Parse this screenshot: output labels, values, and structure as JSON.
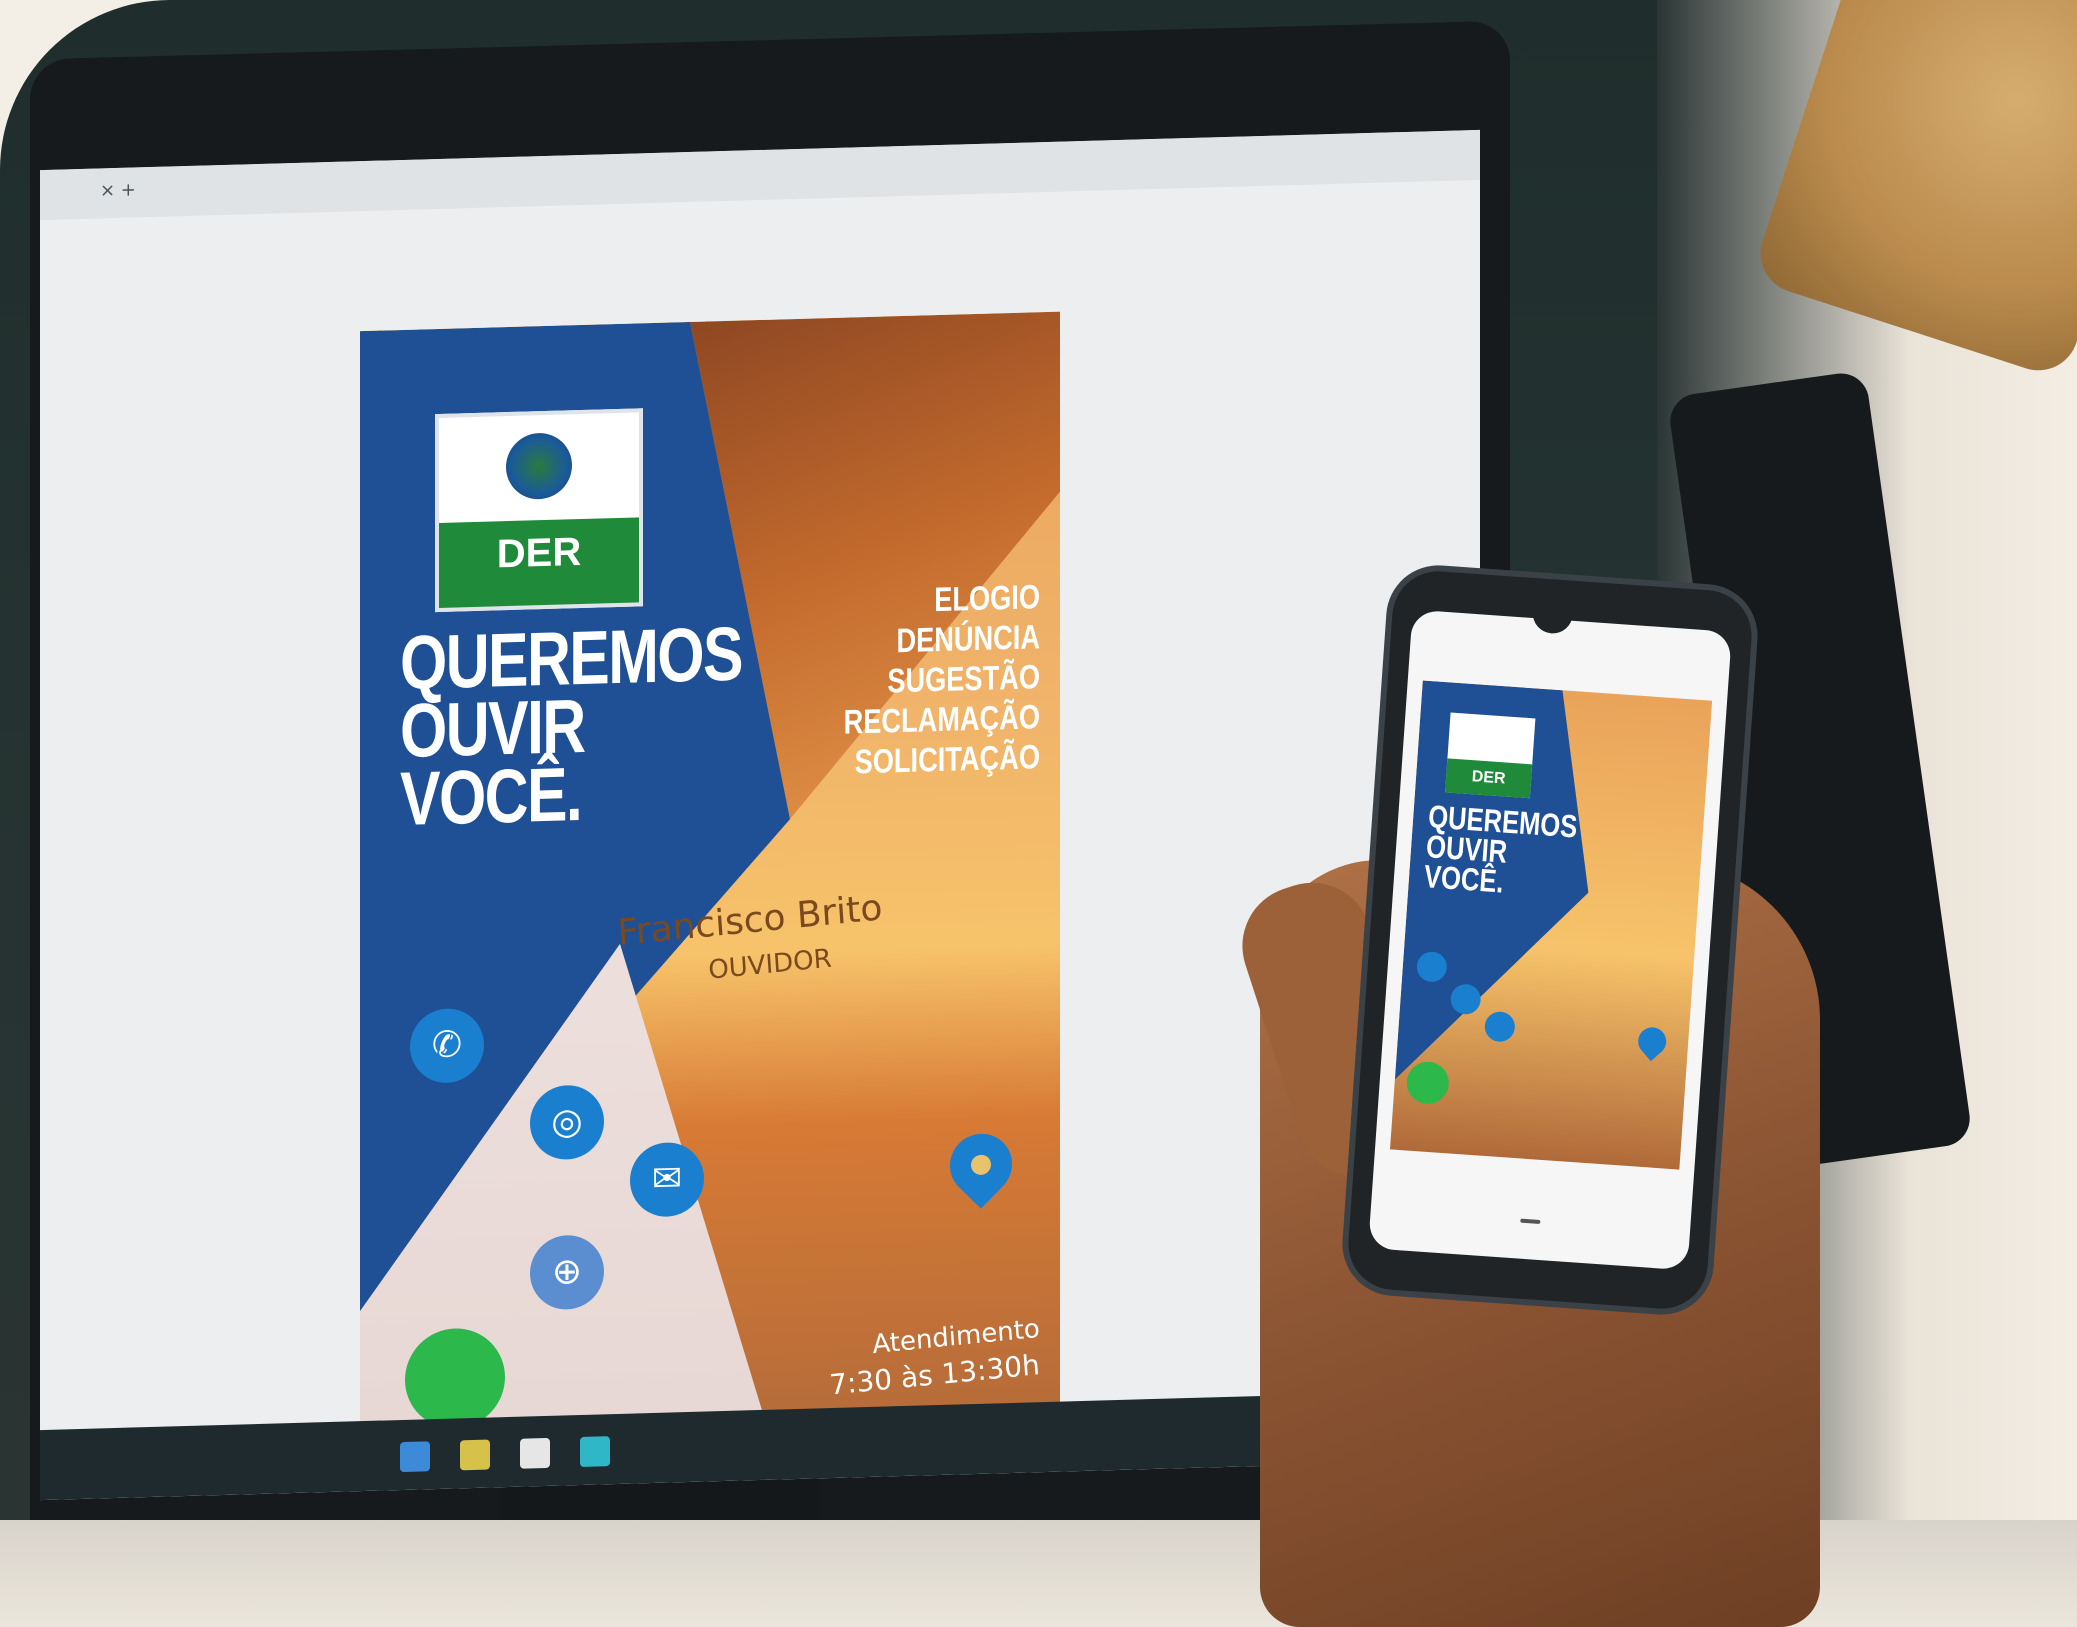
{
  "poster": {
    "logo_brand": "DER",
    "headline": [
      "QUEREMOS",
      "OUVIR",
      "VOCÊ."
    ],
    "categories": [
      "ELOGIO",
      "DENÚNCIA",
      "SUGESTÃO",
      "RECLAMAÇÃO",
      "SOLICITAÇÃO"
    ],
    "ouvidor_name": "Francisco Brito",
    "ouvidor_role": "OUVIDOR",
    "attendance_title": "Atendimento",
    "attendance_hours": "7:30 às 13:30h"
  },
  "phone_poster": {
    "logo_brand": "DER",
    "headline": [
      "QUEREMOS",
      "OUVIR",
      "VOCÊ."
    ]
  },
  "icons": {
    "whatsapp": "whatsapp-icon",
    "email": "email-icon",
    "web": "globe-icon",
    "location": "location-pin-icon"
  },
  "colors": {
    "poster_blue": "#1f4f95",
    "der_green": "#1f8a3a",
    "icon_blue": "#1b7fd0",
    "accent_green": "#2cb84b",
    "sunset_orange": "#f0a655"
  }
}
